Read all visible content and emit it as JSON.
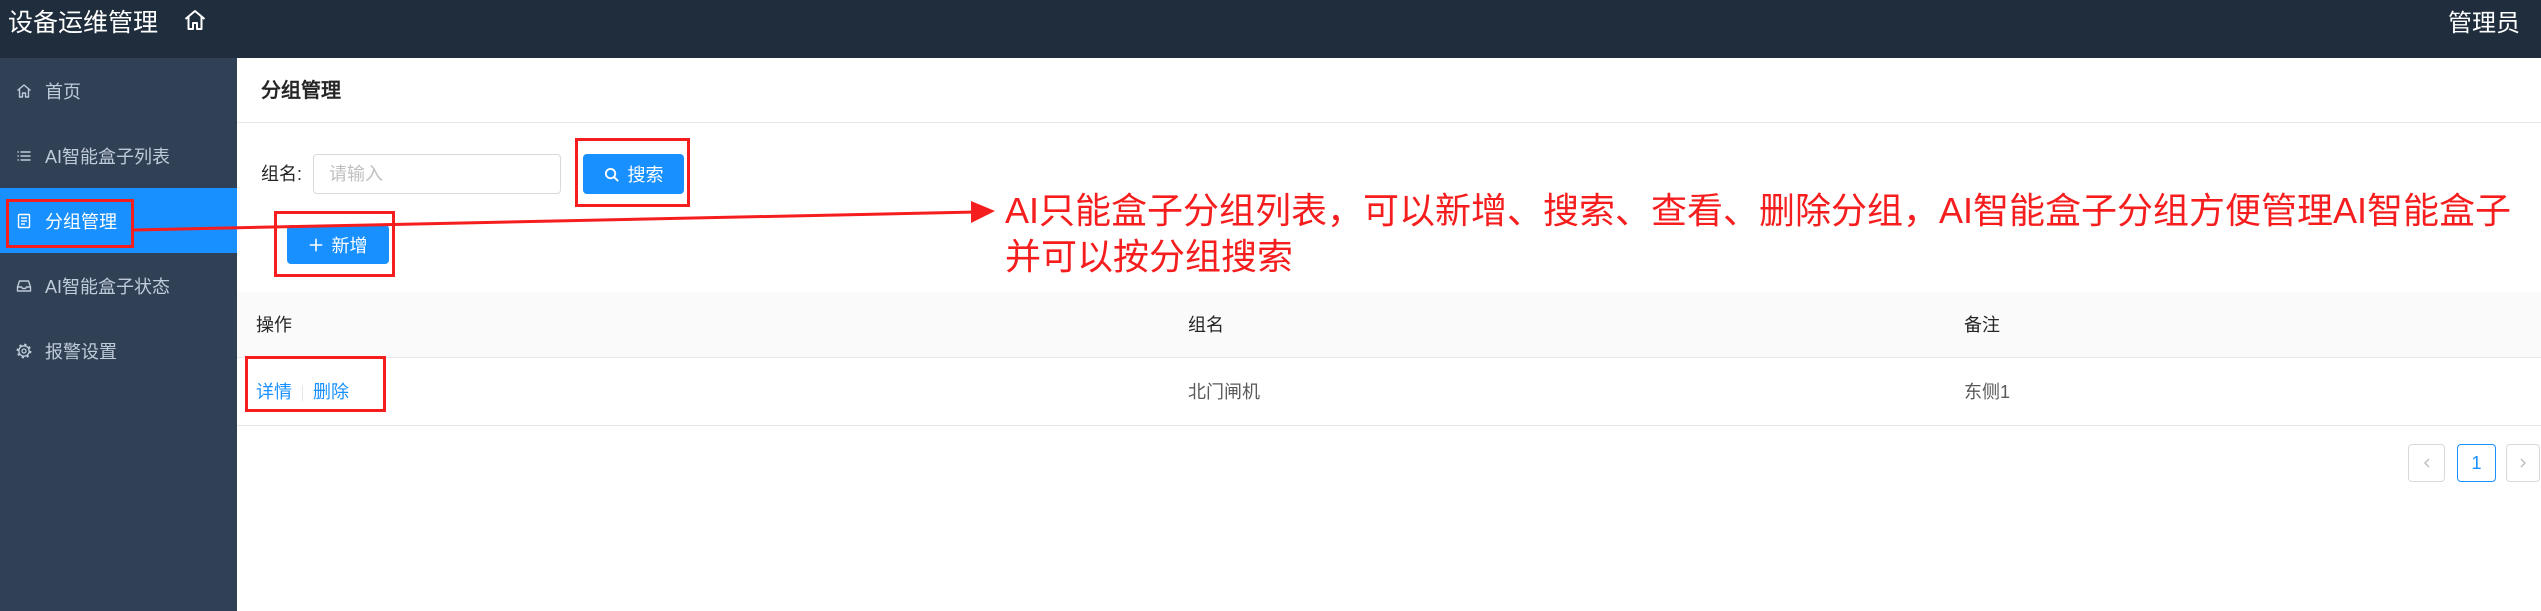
{
  "header": {
    "title": "设备运维管理",
    "home_icon": "home-icon",
    "user": "管理员"
  },
  "sidebar": {
    "items": [
      {
        "label": "首页",
        "icon": "home-icon",
        "active": false
      },
      {
        "label": "AI智能盒子列表",
        "icon": "list-icon",
        "active": false
      },
      {
        "label": "分组管理",
        "icon": "form-icon",
        "active": true
      },
      {
        "label": "AI智能盒子状态",
        "icon": "inbox-icon",
        "active": false
      },
      {
        "label": "报警设置",
        "icon": "gear-icon",
        "active": false
      }
    ]
  },
  "page": {
    "title": "分组管理"
  },
  "search": {
    "label": "组名:",
    "placeholder": "请输入",
    "value": "",
    "button_label": "搜索",
    "button_icon": "search-icon"
  },
  "toolbar": {
    "add_label": "新增",
    "add_icon": "plus-icon"
  },
  "table": {
    "columns": [
      "操作",
      "组名",
      "备注"
    ],
    "rows": [
      {
        "actions": [
          "详情",
          "删除"
        ],
        "name": "北门闸机",
        "remark": "东侧1"
      }
    ]
  },
  "pagination": {
    "current_page": 1,
    "prev_icon": "chevron-left-icon",
    "next_icon": "chevron-right-icon"
  },
  "annotation": {
    "lines": [
      "AI只能盒子分组列表，可以新增、搜索、查看、删除分组，AI智能盒子分组方便管理AI智能盒子",
      "并可以按分组搜索"
    ]
  },
  "colors": {
    "header_bg": "#1f2d3d",
    "sidebar_bg": "#304156",
    "sidebar_text": "#bfcbd9",
    "primary": "#1890ff",
    "annotation": "#f51d1d"
  }
}
